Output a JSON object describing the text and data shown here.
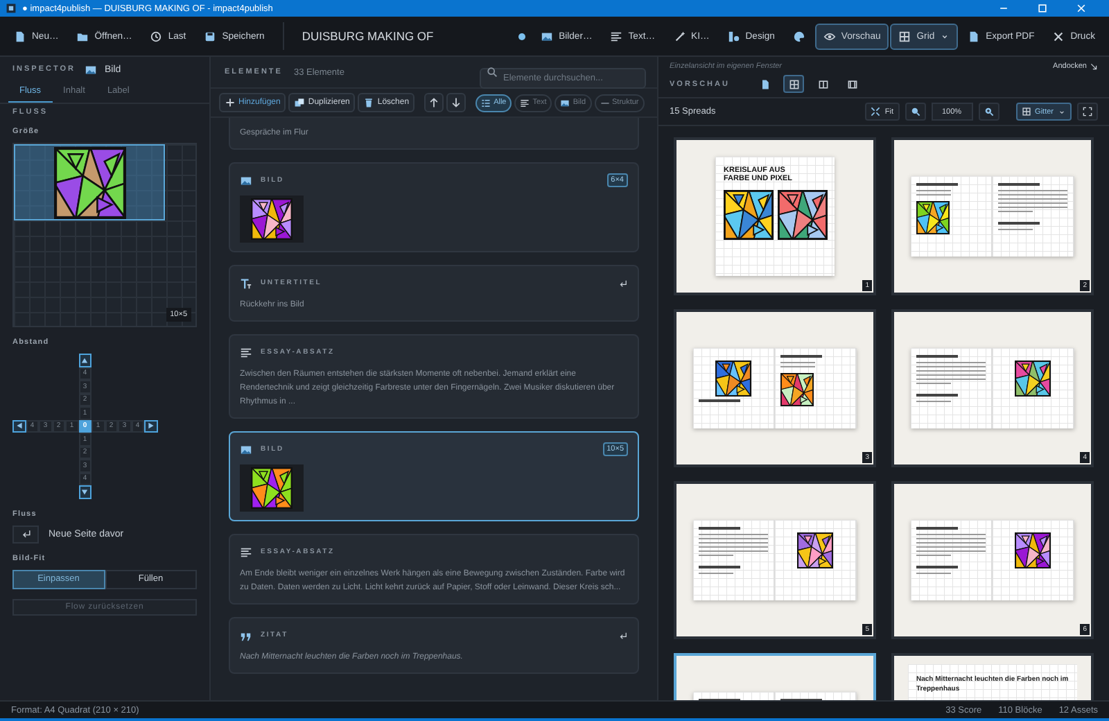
{
  "window": {
    "title": "● impact4publish — DUISBURG MAKING OF - impact4publish"
  },
  "toolbar": {
    "file_actions": [
      {
        "kind": "new",
        "label": "Neu…"
      },
      {
        "kind": "open",
        "label": "Öffnen…"
      },
      {
        "kind": "history",
        "label": "Last"
      },
      {
        "kind": "save",
        "label": "Speichern"
      }
    ],
    "document_title": "DUISBURG MAKING OF",
    "modified": true,
    "tools": [
      {
        "kind": "images",
        "label": "Bilder…",
        "selected": false
      },
      {
        "kind": "text",
        "label": "Text…",
        "selected": false
      },
      {
        "kind": "wand",
        "label": "KI…",
        "selected": false
      },
      {
        "kind": "design",
        "label": "Design",
        "selected": false
      },
      {
        "kind": "palette",
        "selected": false
      },
      {
        "kind": "eye",
        "label": "Vorschau",
        "selected": true
      },
      {
        "kind": "grid",
        "label": "Grid",
        "selected": true,
        "dropdown": true
      },
      {
        "kind": "pdf",
        "label": "Export PDF",
        "selected": false
      },
      {
        "kind": "scissors",
        "label": "Druck",
        "selected": false
      }
    ]
  },
  "inspector": {
    "title": "INSPECTOR",
    "target": "Bild",
    "tabs": [
      {
        "label": "Fluss",
        "selected": true
      },
      {
        "label": "Inhalt",
        "selected": false
      },
      {
        "label": "Label",
        "selected": false
      }
    ],
    "section": "FLUSS",
    "size_label": "Größe",
    "size_badge": "10×5",
    "spacing_label": "Abstand",
    "spacing": {
      "above": [
        {
          "label": "4",
          "selected": false
        },
        {
          "label": "3",
          "selected": false
        },
        {
          "label": "2",
          "selected": false
        },
        {
          "label": "1",
          "selected": false
        }
      ],
      "left": [
        {
          "label": "4",
          "selected": false
        },
        {
          "label": "3",
          "selected": false
        },
        {
          "label": "2",
          "selected": false
        },
        {
          "label": "1",
          "selected": false
        }
      ],
      "center": {
        "label": "0",
        "selected": true
      },
      "right": [
        {
          "label": "1",
          "selected": false
        },
        {
          "label": "2",
          "selected": false
        },
        {
          "label": "3",
          "selected": false
        },
        {
          "label": "4",
          "selected": false
        }
      ],
      "below": [
        {
          "label": "1",
          "selected": false
        },
        {
          "label": "2",
          "selected": false
        },
        {
          "label": "3",
          "selected": false
        },
        {
          "label": "4",
          "selected": false
        }
      ]
    },
    "flow_label": "Fluss",
    "flow_option": "Neue Seite davor",
    "fit_label": "Bild-Fit",
    "fit_options": [
      {
        "label": "Einpassen",
        "selected": true
      },
      {
        "label": "Füllen",
        "selected": false
      }
    ],
    "reset_button": {
      "label": "Flow zurücksetzen",
      "disabled": true
    }
  },
  "elements": {
    "title": "ELEMENTE",
    "count": "33 Elemente",
    "search": {
      "placeholder": "Elemente durchsuchen..."
    },
    "actions": [
      {
        "kind": "add",
        "label": "Hinzufügen"
      },
      {
        "kind": "duplicate",
        "label": "Duplizieren"
      },
      {
        "kind": "delete",
        "label": "Löschen"
      },
      {
        "kind": "up"
      },
      {
        "kind": "down"
      }
    ],
    "filters": [
      {
        "kind": "all",
        "label": "Alle",
        "selected": true
      },
      {
        "kind": "text",
        "label": "Text",
        "selected": false
      },
      {
        "kind": "image",
        "label": "Bild",
        "selected": false
      },
      {
        "kind": "structure",
        "label": "Struktur",
        "selected": false
      }
    ],
    "items": [
      {
        "kind": "partial",
        "text": "Gespräche im Flur",
        "selected": false
      },
      {
        "kind": "image",
        "label": "BILD",
        "badge": "6×4",
        "selected": false
      },
      {
        "kind": "subtitle",
        "label": "UNTERTITEL",
        "text": "Rückkehr ins Bild",
        "selected": false
      },
      {
        "kind": "essay",
        "label": "ESSAY-ABSATZ",
        "text": "Zwischen den Räumen entstehen die stärksten Momente oft nebenbei. Jemand erklärt eine Rendertechnik und zeigt gleichzeitig Farbreste unter den Fingernägeln. Zwei Musiker diskutieren über Rhythmus in ...",
        "selected": false
      },
      {
        "kind": "image",
        "label": "BILD",
        "badge": "10×5",
        "selected": true
      },
      {
        "kind": "essay",
        "label": "ESSAY-ABSATZ",
        "text": "Am Ende bleibt weniger ein einzelnes Werk hängen als eine Bewegung zwischen Zuständen. Farbe wird zu Daten. Daten werden zu Licht. Licht kehrt zurück auf Papier, Stoff oder Leinwand. Dieser Kreis sch...",
        "selected": false
      },
      {
        "kind": "quote",
        "label": "ZITAT",
        "text": "Nach Mitternacht leuchten die Farben noch im Treppenhaus.",
        "selected": false
      }
    ]
  },
  "preview": {
    "hint": "Einzelansicht im eigenen Fenster",
    "dock_link": "Andocken",
    "title": "VORSCHAU",
    "views": [
      {
        "kind": "page",
        "selected": false
      },
      {
        "kind": "grid",
        "selected": true
      },
      {
        "kind": "columns",
        "selected": false
      },
      {
        "kind": "film",
        "selected": false
      }
    ],
    "spread_count": "15 Spreads",
    "fit_button": "Fit",
    "zoom": "100%",
    "layout_button": {
      "label": "Gitter",
      "selected": true
    },
    "spreads": [
      {
        "kind": "cover",
        "number": "1",
        "title": "KREISLAUF AUS FARBE UND PIXEL",
        "selected": false
      },
      {
        "kind": "spread",
        "number": "2",
        "pages": [
          {
            "kind": "text-image"
          },
          {
            "kind": "text"
          }
        ],
        "selected": false
      },
      {
        "kind": "spread",
        "number": "3",
        "pages": [
          {
            "kind": "image-text"
          },
          {
            "kind": "text-image"
          }
        ],
        "selected": false
      },
      {
        "kind": "spread",
        "number": "4",
        "pages": [
          {
            "kind": "text"
          },
          {
            "kind": "image"
          }
        ],
        "selected": false
      },
      {
        "kind": "spread",
        "number": "5",
        "pages": [
          {
            "kind": "text"
          },
          {
            "kind": "image"
          }
        ],
        "selected": false
      },
      {
        "kind": "spread",
        "number": "6",
        "pages": [
          {
            "kind": "text"
          },
          {
            "kind": "image"
          }
        ],
        "selected": false
      },
      {
        "kind": "spread",
        "pages": [
          {
            "kind": "text"
          },
          {
            "kind": "text"
          }
        ],
        "selected": true
      },
      {
        "kind": "quote",
        "text": "Nach Mitternacht leuchten die Farben noch im Treppenhaus",
        "selected": false
      }
    ]
  },
  "status_bar": {
    "format": "Format: A4 Quadrat (210 × 210)",
    "stats": [
      "33 Score",
      "110 Blöcke",
      "12 Assets"
    ]
  }
}
